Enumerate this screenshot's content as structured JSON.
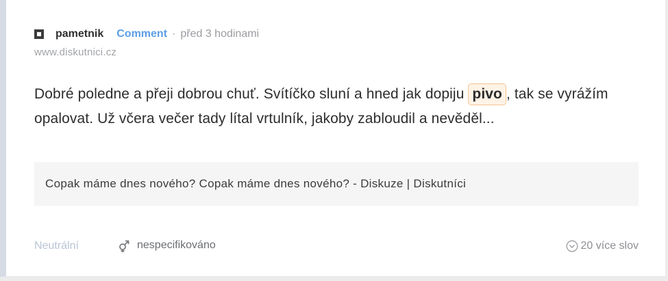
{
  "post": {
    "author": "pametnik",
    "type_label": "Comment",
    "separator": "·",
    "time": "před 3 hodinami",
    "source": "www.diskutnici.cz",
    "text_before": "Dobré poledne a přeji dobrou chuť. Svítíčko sluní a hned jak dopiju ",
    "highlight": "pivo",
    "text_after": ", tak se vyrážím opalovat. Už včera večer tady lítal vrtulník, jakoby zabloudil a nevěděl..."
  },
  "link": {
    "title": "Copak máme dnes nového? Copak máme dnes nového? - Diskuze | Diskutníci"
  },
  "footer": {
    "sentiment": "Neutrální",
    "gender": "nespecifikováno",
    "more": "20 více slov"
  },
  "icons": {
    "source": "square-outline-icon",
    "gender": "gender-icon",
    "more": "chevron-down-circle-icon"
  },
  "colors": {
    "accent": "#5b9ee6",
    "highlight_bg": "#fff3e6",
    "highlight_border": "#f2c591",
    "sentiment": "#b8c4d4"
  }
}
